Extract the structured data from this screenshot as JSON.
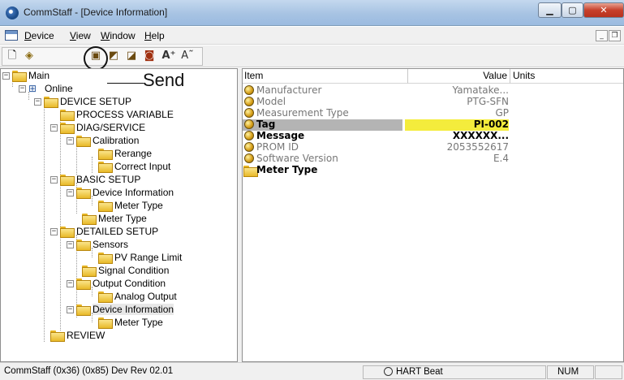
{
  "window": {
    "title": "CommStaff - [Device Information]"
  },
  "menu": [
    {
      "label": "Device"
    },
    {
      "label": "View"
    },
    {
      "label": "Window"
    },
    {
      "label": "Help"
    }
  ],
  "toolbar": {
    "icons": [
      "new-icon",
      "open-icon",
      "send-icon",
      "receive-icon",
      "refresh-icon",
      "upload-icon",
      "increase-font-icon",
      "decrease-font-icon"
    ]
  },
  "annotation": {
    "send_label": "Send"
  },
  "tree": [
    {
      "label": "Main",
      "depth": 0,
      "expander": "−",
      "icon": "folder-icon"
    },
    {
      "label": "Online",
      "depth": 1,
      "expander": "−",
      "icon": "online-icon"
    },
    {
      "label": "DEVICE SETUP",
      "depth": 2,
      "expander": "−",
      "icon": "folder-icon"
    },
    {
      "label": "PROCESS VARIABLE",
      "depth": 3,
      "expander": "",
      "icon": "folder-icon"
    },
    {
      "label": "DIAG/SERVICE",
      "depth": 3,
      "expander": "−",
      "icon": "folder-icon"
    },
    {
      "label": "Calibration",
      "depth": 4,
      "expander": "−",
      "icon": "folder-icon"
    },
    {
      "label": "Rerange",
      "depth": 5,
      "expander": "",
      "icon": "folder-icon"
    },
    {
      "label": "Correct Input",
      "depth": 5,
      "expander": "",
      "icon": "folder-icon"
    },
    {
      "label": "BASIC SETUP",
      "depth": 3,
      "expander": "−",
      "icon": "folder-icon"
    },
    {
      "label": "Device Information",
      "depth": 4,
      "expander": "−",
      "icon": "folder-icon"
    },
    {
      "label": "Meter Type",
      "depth": 5,
      "expander": "",
      "icon": "folder-icon"
    },
    {
      "label": "Meter Type",
      "depth": 4,
      "expander": "",
      "icon": "folder-icon"
    },
    {
      "label": "DETAILED SETUP",
      "depth": 3,
      "expander": "−",
      "icon": "folder-icon"
    },
    {
      "label": "Sensors",
      "depth": 4,
      "expander": "−",
      "icon": "folder-icon"
    },
    {
      "label": "PV Range Limit",
      "depth": 5,
      "expander": "",
      "icon": "folder-icon"
    },
    {
      "label": "Signal Condition",
      "depth": 4,
      "expander": "",
      "icon": "folder-icon"
    },
    {
      "label": "Output Condition",
      "depth": 4,
      "expander": "−",
      "icon": "folder-icon"
    },
    {
      "label": "Analog Output",
      "depth": 5,
      "expander": "",
      "icon": "folder-icon"
    },
    {
      "label": "Device Information",
      "depth": 4,
      "expander": "−",
      "icon": "open-folder-icon",
      "selected": true
    },
    {
      "label": "Meter Type",
      "depth": 5,
      "expander": "",
      "icon": "folder-icon"
    },
    {
      "label": "REVIEW",
      "depth": 2,
      "expander": "",
      "icon": "folder-icon"
    }
  ],
  "list": {
    "columns": [
      "Item",
      "Value",
      "Units"
    ],
    "rows": [
      {
        "item": "Manufacturer",
        "value": "Yamatake...",
        "units": "",
        "icon": "variable-icon",
        "style": "readonly"
      },
      {
        "item": "Model",
        "value": "PTG-SFN",
        "units": "",
        "icon": "variable-icon",
        "style": "readonly"
      },
      {
        "item": "Measurement Type",
        "value": "GP",
        "units": "",
        "icon": "variable-icon",
        "style": "readonly"
      },
      {
        "item": "Tag",
        "value": "PI-002",
        "units": "",
        "icon": "variable-icon",
        "style": "edited-selected"
      },
      {
        "item": "Message",
        "value": "XXXXXX...",
        "units": "",
        "icon": "variable-icon",
        "style": "edited"
      },
      {
        "item": "PROM ID",
        "value": "2053552617",
        "units": "",
        "icon": "variable-icon",
        "style": "readonly"
      },
      {
        "item": "Software Version",
        "value": "E.4",
        "units": "",
        "icon": "variable-icon",
        "style": "readonly"
      },
      {
        "item": "Meter Type",
        "value": "",
        "units": "",
        "icon": "folder-icon",
        "style": "folder"
      }
    ]
  },
  "status": {
    "device": "CommStaff  (0x36)  (0x85) Dev Rev 02.01",
    "beat": "HART Beat",
    "num": "NUM"
  },
  "colors": {
    "highlight_value": "#f4ec3c",
    "highlight_item": "#b4b4b4",
    "folder": "#e8b928"
  }
}
